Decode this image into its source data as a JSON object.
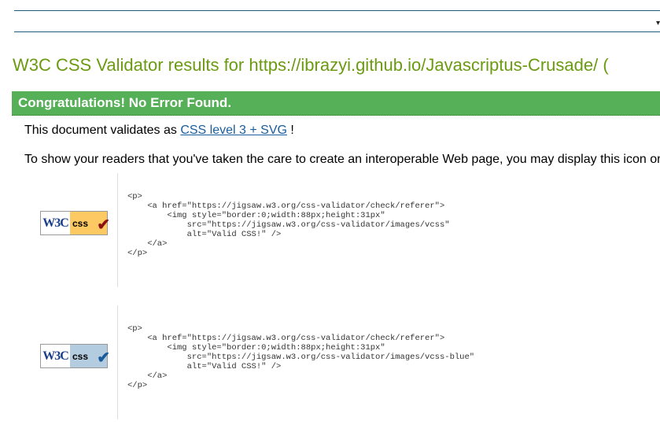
{
  "title": "W3C CSS Validator results for https://ibrazyi.github.io/Javascriptus-Crusade/ (",
  "banner": "Congratulations! No Error Found.",
  "validates": {
    "prefix": "This document validates as ",
    "link": "CSS level 3 + SVG",
    "suffix": " !"
  },
  "interop_text": "To show your readers that you've taken the care to create an interoperable Web page, you may display this icon on",
  "badges": [
    {
      "w3c": "W3C",
      "css": "css",
      "bg": "#fcc962",
      "check_color": "#8b1111",
      "code": "<p>\n    <a href=\"https://jigsaw.w3.org/css-validator/check/referer\">\n        <img style=\"border:0;width:88px;height:31px\"\n            src=\"https://jigsaw.w3.org/css-validator/images/vcss\"\n            alt=\"Valid CSS!\" />\n    </a>\n</p>"
    },
    {
      "w3c": "W3C",
      "css": "css",
      "bg": "#b4cce0",
      "check_color": "#1a5a9a",
      "code": "<p>\n    <a href=\"https://jigsaw.w3.org/css-validator/check/referer\">\n        <img style=\"border:0;width:88px;height:31px\"\n            src=\"https://jigsaw.w3.org/css-validator/images/vcss-blue\"\n            alt=\"Valid CSS!\" />\n    </a>\n</p>"
    }
  ]
}
